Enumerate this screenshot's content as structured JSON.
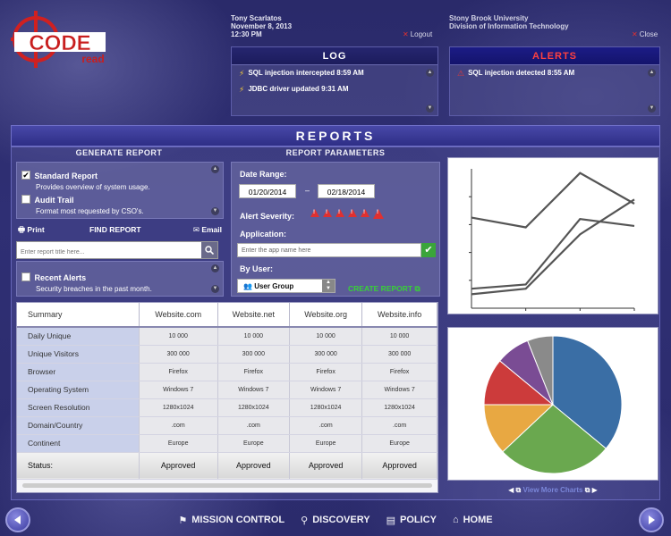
{
  "brand": {
    "logo_word": "CODE",
    "logo_sub": "read"
  },
  "user": {
    "name": "Tony Scarlatos",
    "date": "November 8, 2013",
    "time": "12:30 PM",
    "logout": "Logout"
  },
  "org": {
    "line1": "Stony Brook University",
    "line2": "Division of Information Technology",
    "close": "Close"
  },
  "log": {
    "title": "LOG",
    "entries": [
      "SQL injection intercepted 8:59 AM",
      "JDBC driver updated 9:31 AM"
    ]
  },
  "alerts": {
    "title": "ALERTS",
    "entries": [
      "SQL injection detected 8:55 AM"
    ]
  },
  "reports": {
    "title": "REPORTS",
    "generate_title": "GENERATE REPORT",
    "params_title": "REPORT PARAMETERS",
    "types": [
      {
        "title": "Standard Report",
        "desc": "Provides overview of system usage.",
        "checked": true
      },
      {
        "title": "Audit Trail",
        "desc": "Format most requested by CSO's.",
        "checked": false
      }
    ],
    "print": "Print",
    "find": "FIND REPORT",
    "email": "Email",
    "search_placeholder": "Enter report title here...",
    "recent": {
      "title": "Recent Alerts",
      "desc": "Security breaches in the past month."
    }
  },
  "params": {
    "date_label": "Date Range:",
    "date_from": "01/20/2014",
    "date_sep": "–",
    "date_to": "02/18/2014",
    "severity_label": "Alert Severity:",
    "severity_levels": 6,
    "app_label": "Application:",
    "app_placeholder": "Enter the app name here",
    "user_label": "By User:",
    "user_group": "User Group",
    "create": "CREATE REPORT"
  },
  "table": {
    "headers": [
      "Summary",
      "Website.com",
      "Website.net",
      "Website.org",
      "Website.info"
    ],
    "rows": [
      {
        "label": "Daily Unique",
        "values": [
          "10 000",
          "10 000",
          "10 000",
          "10 000"
        ]
      },
      {
        "label": "Unique Visitors",
        "values": [
          "300 000",
          "300 000",
          "300 000",
          "300 000"
        ]
      },
      {
        "label": "Browser",
        "values": [
          "Firefox",
          "Firefox",
          "Firefox",
          "Firefox"
        ]
      },
      {
        "label": "Operating System",
        "values": [
          "Windows 7",
          "Windows 7",
          "Windows 7",
          "Windows 7"
        ]
      },
      {
        "label": "Screen Resolution",
        "values": [
          "1280x1024",
          "1280x1024",
          "1280x1024",
          "1280x1024"
        ]
      },
      {
        "label": "Domain/Country",
        "values": [
          ".com",
          ".com",
          ".com",
          ".com"
        ]
      },
      {
        "label": "Continent",
        "values": [
          "Europe",
          "Europe",
          "Europe",
          "Europe"
        ]
      }
    ],
    "status": {
      "label": "Status:",
      "values": [
        "Approved",
        "Approved",
        "Approved",
        "Approved"
      ]
    }
  },
  "charts_more": "View More Charts",
  "nav": [
    "MISSION CONTROL",
    "DISCOVERY",
    "POLICY",
    "HOME"
  ],
  "colors": {
    "pie": [
      "#3a6ea5",
      "#6aa84f",
      "#e8a842",
      "#cc3b3b",
      "#7a4c94",
      "#8a8a8a"
    ],
    "line": "#555555",
    "accent_green": "#38d038",
    "alert_red": "#e03030"
  },
  "chart_data": [
    {
      "type": "line",
      "x": [
        0,
        1,
        2,
        3
      ],
      "series": [
        {
          "values": [
            65,
            58,
            97,
            75
          ]
        },
        {
          "values": [
            10,
            14,
            53,
            78
          ]
        },
        {
          "values": [
            14,
            17,
            64,
            59
          ]
        }
      ],
      "ylim": [
        0,
        100
      ],
      "grid": false
    },
    {
      "type": "pie",
      "values": [
        36,
        27,
        12,
        11,
        8,
        6
      ]
    }
  ]
}
